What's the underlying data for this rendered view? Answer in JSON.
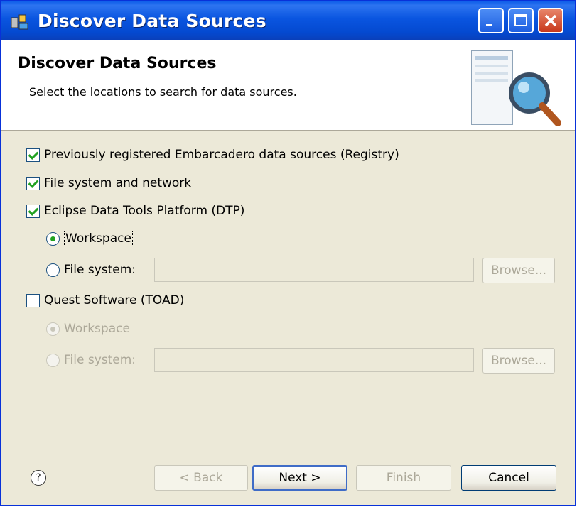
{
  "window": {
    "title": "Discover Data Sources",
    "title_icon": "discover-data-sources-icon",
    "minimize_icon": "minimize-icon",
    "maximize_icon": "maximize-icon",
    "close_icon": "close-icon"
  },
  "header": {
    "title": "Discover Data Sources",
    "description": "Select the locations to search for data sources.",
    "graphic": "server-search-icon"
  },
  "options": {
    "registry": {
      "label": "Previously registered Embarcadero data sources (Registry)",
      "checked": true
    },
    "filesystem_network": {
      "label": "File system and network",
      "checked": true
    },
    "dtp": {
      "label": "Eclipse Data Tools Platform (DTP)",
      "checked": true,
      "workspace_label": "Workspace",
      "workspace_selected": true,
      "filesystem_label": "File system:",
      "filesystem_value": "",
      "browse_label": "Browse..."
    },
    "toad": {
      "label": "Quest Software (TOAD)",
      "checked": false,
      "workspace_label": "Workspace",
      "workspace_selected": true,
      "filesystem_label": "File system:",
      "filesystem_value": "",
      "browse_label": "Browse..."
    }
  },
  "footer": {
    "help_icon": "help-icon",
    "help_glyph": "?",
    "back_label": "< Back",
    "next_label": "Next >",
    "finish_label": "Finish",
    "cancel_label": "Cancel"
  }
}
